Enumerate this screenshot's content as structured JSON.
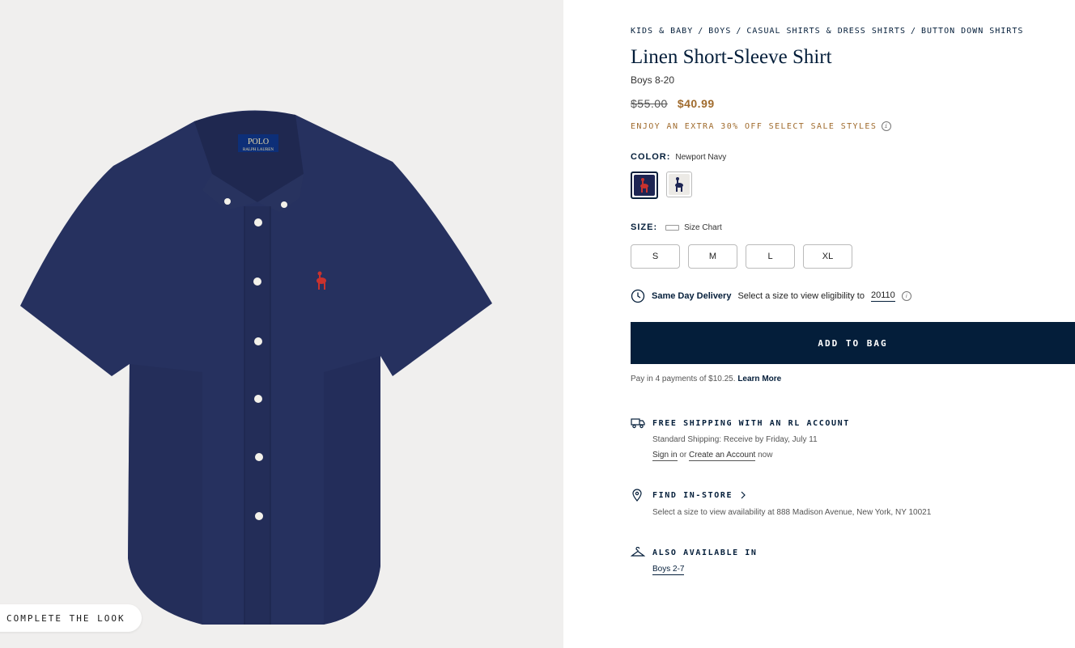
{
  "image": {
    "complete_look_label": "COMPLETE THE LOOK",
    "label_brand": "POLO",
    "label_sub": "RALPH LAUREN"
  },
  "breadcrumb": [
    "KIDS & BABY",
    "BOYS",
    "CASUAL SHIRTS & DRESS SHIRTS",
    "BUTTON DOWN SHIRTS"
  ],
  "breadcrumb_separator": "/",
  "product": {
    "title": "Linen Short-Sleeve Shirt",
    "subtitle": "Boys 8-20",
    "price_original": "$55.00",
    "price_sale": "$40.99",
    "promo": "ENJOY AN EXTRA 30% OFF SELECT SALE STYLES"
  },
  "color": {
    "label": "COLOR:",
    "selected": "Newport Navy",
    "swatches": [
      "Newport Navy",
      "White"
    ]
  },
  "size": {
    "label": "SIZE:",
    "chart_label": "Size Chart",
    "options": [
      "S",
      "M",
      "L",
      "XL"
    ]
  },
  "delivery": {
    "title": "Same Day Delivery",
    "text": "Select a size to view eligibility to",
    "zip": "20110"
  },
  "cta": {
    "add_to_bag": "ADD TO BAG"
  },
  "installments": {
    "text": "Pay in 4 payments of $10.25.",
    "learn_more": "Learn More"
  },
  "shipping": {
    "title": "FREE SHIPPING WITH AN RL ACCOUNT",
    "line1": "Standard Shipping: Receive by Friday, July 11",
    "sign_in": "Sign in",
    "or": "or",
    "create": "Create an Account",
    "now": "now"
  },
  "store": {
    "title": "FIND IN-STORE",
    "line": "Select a size to view availability at 888 Madison Avenue, New York, NY 10021"
  },
  "also": {
    "title": "ALSO AVAILABLE IN",
    "link": "Boys 2-7"
  },
  "colors": {
    "navy": "#041e3a",
    "gold": "#a06b2d",
    "shirt": "#25305e"
  }
}
